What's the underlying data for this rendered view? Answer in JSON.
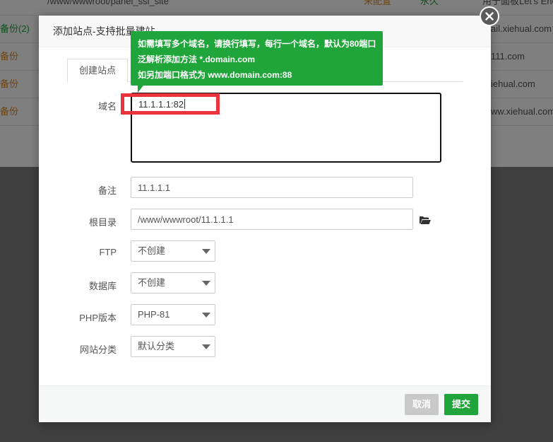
{
  "background_table": {
    "top_row": {
      "path": "/www/wwwroot/panel_ssl_site",
      "status": "未配置",
      "expire": "永久",
      "note": "用于面板Let's Enc"
    },
    "rows": [
      {
        "backup": "备份(2)",
        "note": "ail.xiehual.com",
        "backup_color": "#20a53a"
      },
      {
        "backup": "备份",
        "note": "111.com",
        "backup_color": "#e08a1e"
      },
      {
        "backup": "备份",
        "note": "iehual.com",
        "backup_color": "#e08a1e"
      },
      {
        "backup": "备份",
        "note": "ww.xiehual.com",
        "backup_color": "#e08a1e"
      }
    ]
  },
  "modal": {
    "title": "添加站点-支持批量建站",
    "tab_create": "创建站点",
    "tooltip": {
      "line1": "如需填写多个域名，请换行填写，每行一个域名，默认为80端口",
      "line2": "泛解析添加方法 *.domain.com",
      "line3": "如另加端口格式为 www.domain.com:88"
    },
    "form": {
      "domain_label": "域名",
      "domain_value": "11.1.1.1:82",
      "note_label": "备注",
      "note_value": "11.1.1.1",
      "root_label": "根目录",
      "root_value": "/www/wwwroot/11.1.1.1",
      "ftp_label": "FTP",
      "ftp_value": "不创建",
      "db_label": "数据库",
      "db_value": "不创建",
      "php_label": "PHP版本",
      "php_value": "PHP-81",
      "category_label": "网站分类",
      "category_value": "默认分类"
    },
    "footer": {
      "cancel_label": "取消",
      "submit_label": "提交"
    }
  },
  "colors": {
    "accent_green": "#20a53a",
    "highlight_red": "#e8343a",
    "cancel_gray": "#c9c9c9"
  },
  "icons": [
    "close-icon",
    "folder-open-icon",
    "chevron-down-icon"
  ]
}
